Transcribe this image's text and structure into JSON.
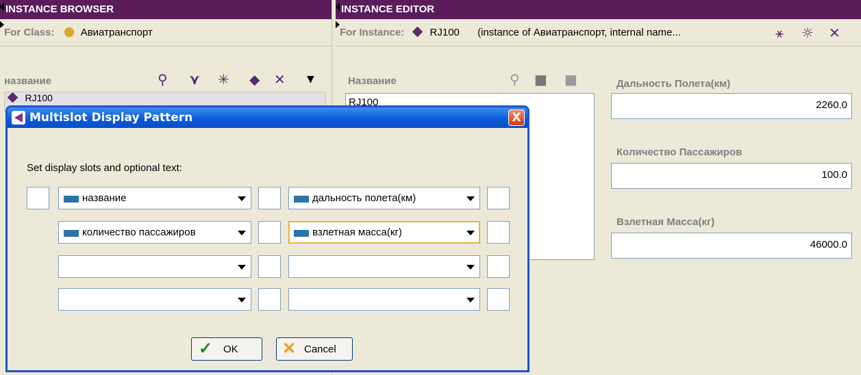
{
  "browser": {
    "header": "INSTANCE BROWSER",
    "for_label": "For Class:",
    "class_name": "Авиатранспорт",
    "column_label": "название",
    "selected_item": "RJ100",
    "toolbar_icons": [
      "find-icon",
      "references-icon",
      "create-icon",
      "diamond-icon",
      "delete-icon",
      "menu-icon"
    ]
  },
  "editor": {
    "header": "INSTANCE EDITOR",
    "for_label": "For Instance:",
    "instance_name": "RJ100",
    "instance_desc": "(instance of Авиатранспорт, internal name...",
    "name_label": "Название",
    "name_value": "RJ100",
    "fields": [
      {
        "label": "Дальность Полета(км)",
        "value": "2260.0"
      },
      {
        "label": "Количество Пассажиров",
        "value": "100.0"
      },
      {
        "label": "Взлетная Масса(кг)",
        "value": "46000.0"
      }
    ]
  },
  "dialog": {
    "title": "Multislot Display Pattern",
    "close": "X",
    "instruction": "Set display slots and optional text:",
    "rows": [
      {
        "left": "название",
        "right": "дальность полета(км)"
      },
      {
        "left": "количество пассажиров",
        "right": "взлетная масса(кг)"
      },
      {
        "left": "",
        "right": ""
      },
      {
        "left": "",
        "right": ""
      }
    ],
    "ok_label": "OK",
    "cancel_label": "Cancel"
  },
  "colors": {
    "header_bg": "#5b1c5c",
    "panel_bg": "#ece9d8",
    "title_blue": "#0a58d8",
    "slot_swatch": "#2c73a8"
  }
}
